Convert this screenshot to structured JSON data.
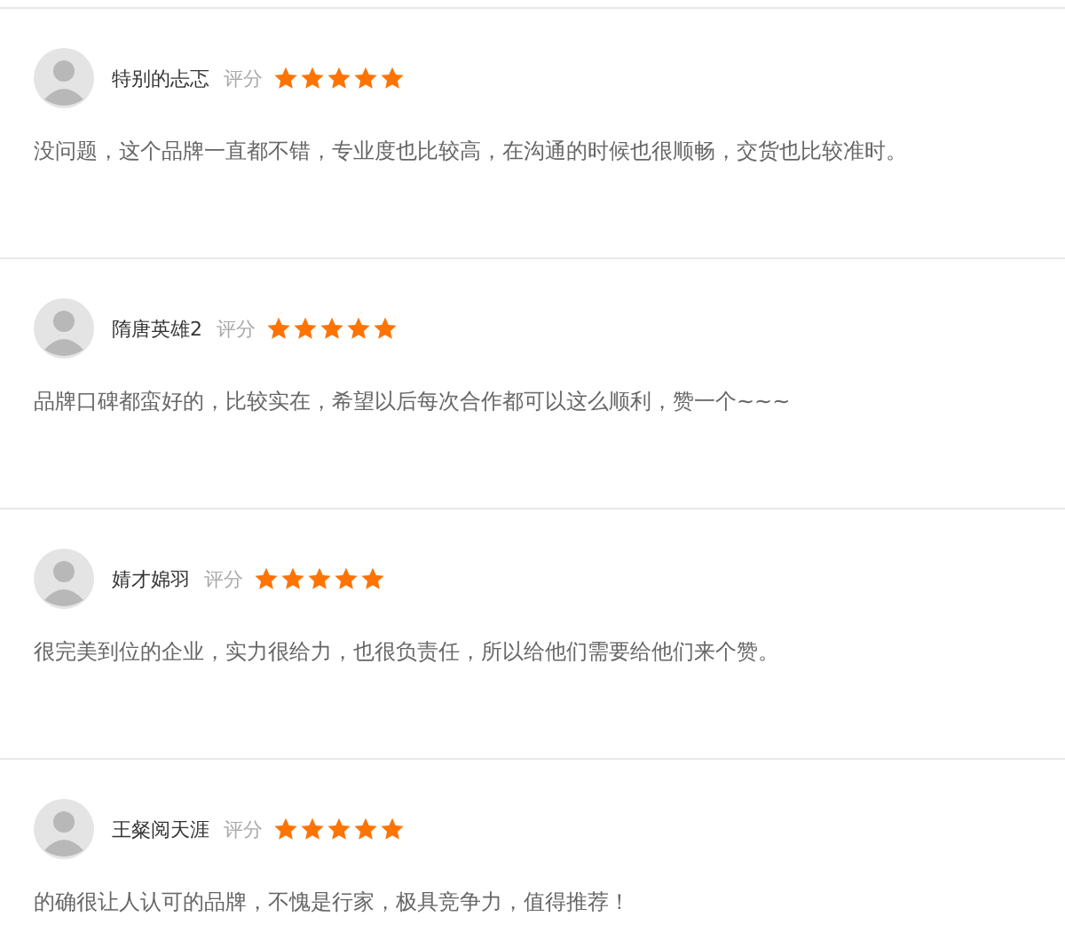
{
  "reviews": [
    {
      "name": "特别的忐忑",
      "rating_label": "评分",
      "stars": 5,
      "text": "没问题，这个品牌一直都不错，专业度也比较高，在沟通的时候也很顺畅，交货也比较准时。"
    },
    {
      "name": "隋唐英雄2",
      "rating_label": "评分",
      "stars": 5,
      "text": "品牌口碑都蛮好的，比较实在，希望以后每次合作都可以这么顺利，赞一个~~~"
    },
    {
      "name": "婧才婂羽",
      "rating_label": "评分",
      "stars": 5,
      "text": "很完美到位的企业，实力很给力，也很负责任，所以给他们需要给他们来个赞。"
    },
    {
      "name": "王粲阅天涯",
      "rating_label": "评分",
      "stars": 5,
      "text": "的确很让人认可的品牌，不愧是行家，极具竞争力，值得推荐！"
    }
  ]
}
